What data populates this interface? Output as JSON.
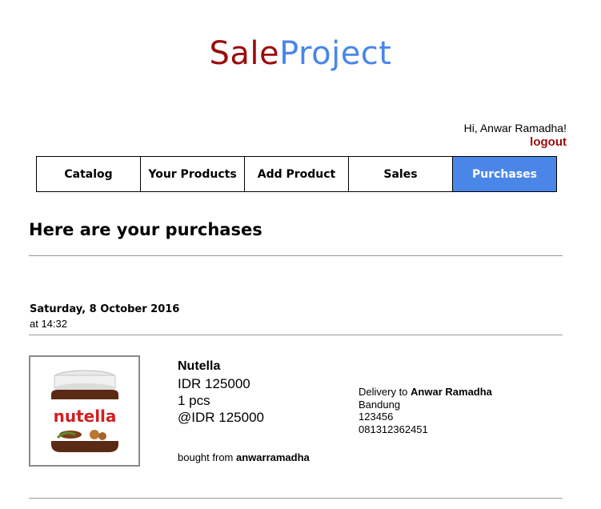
{
  "brand": {
    "part1": "Sale",
    "part2": "Project"
  },
  "user": {
    "greeting": "Hi, Anwar Ramadha!",
    "logout_label": "logout"
  },
  "nav": {
    "items": [
      {
        "label": "Catalog",
        "active": false
      },
      {
        "label": "Your Products",
        "active": false
      },
      {
        "label": "Add Product",
        "active": false
      },
      {
        "label": "Sales",
        "active": false
      },
      {
        "label": "Purchases",
        "active": true
      }
    ]
  },
  "page": {
    "title": "Here are your purchases"
  },
  "purchases": [
    {
      "date": "Saturday, 8 October 2016",
      "time": "at 14:32",
      "image_alt": "nutella",
      "product_name": "Nutella",
      "total": "IDR 125000",
      "quantity": "1 pcs",
      "unit_price": "@IDR 125000",
      "bought_from_prefix": "bought from",
      "seller": "anwarramadha",
      "delivery_prefix": "Delivery to",
      "recipient": "Anwar Ramadha",
      "city": "Bandung",
      "postal_code": "123456",
      "phone": "081312362451"
    }
  ],
  "colors": {
    "brand_red": "#9a0c0c",
    "brand_blue": "#4a86e8",
    "active_tab": "#4a86e8"
  }
}
